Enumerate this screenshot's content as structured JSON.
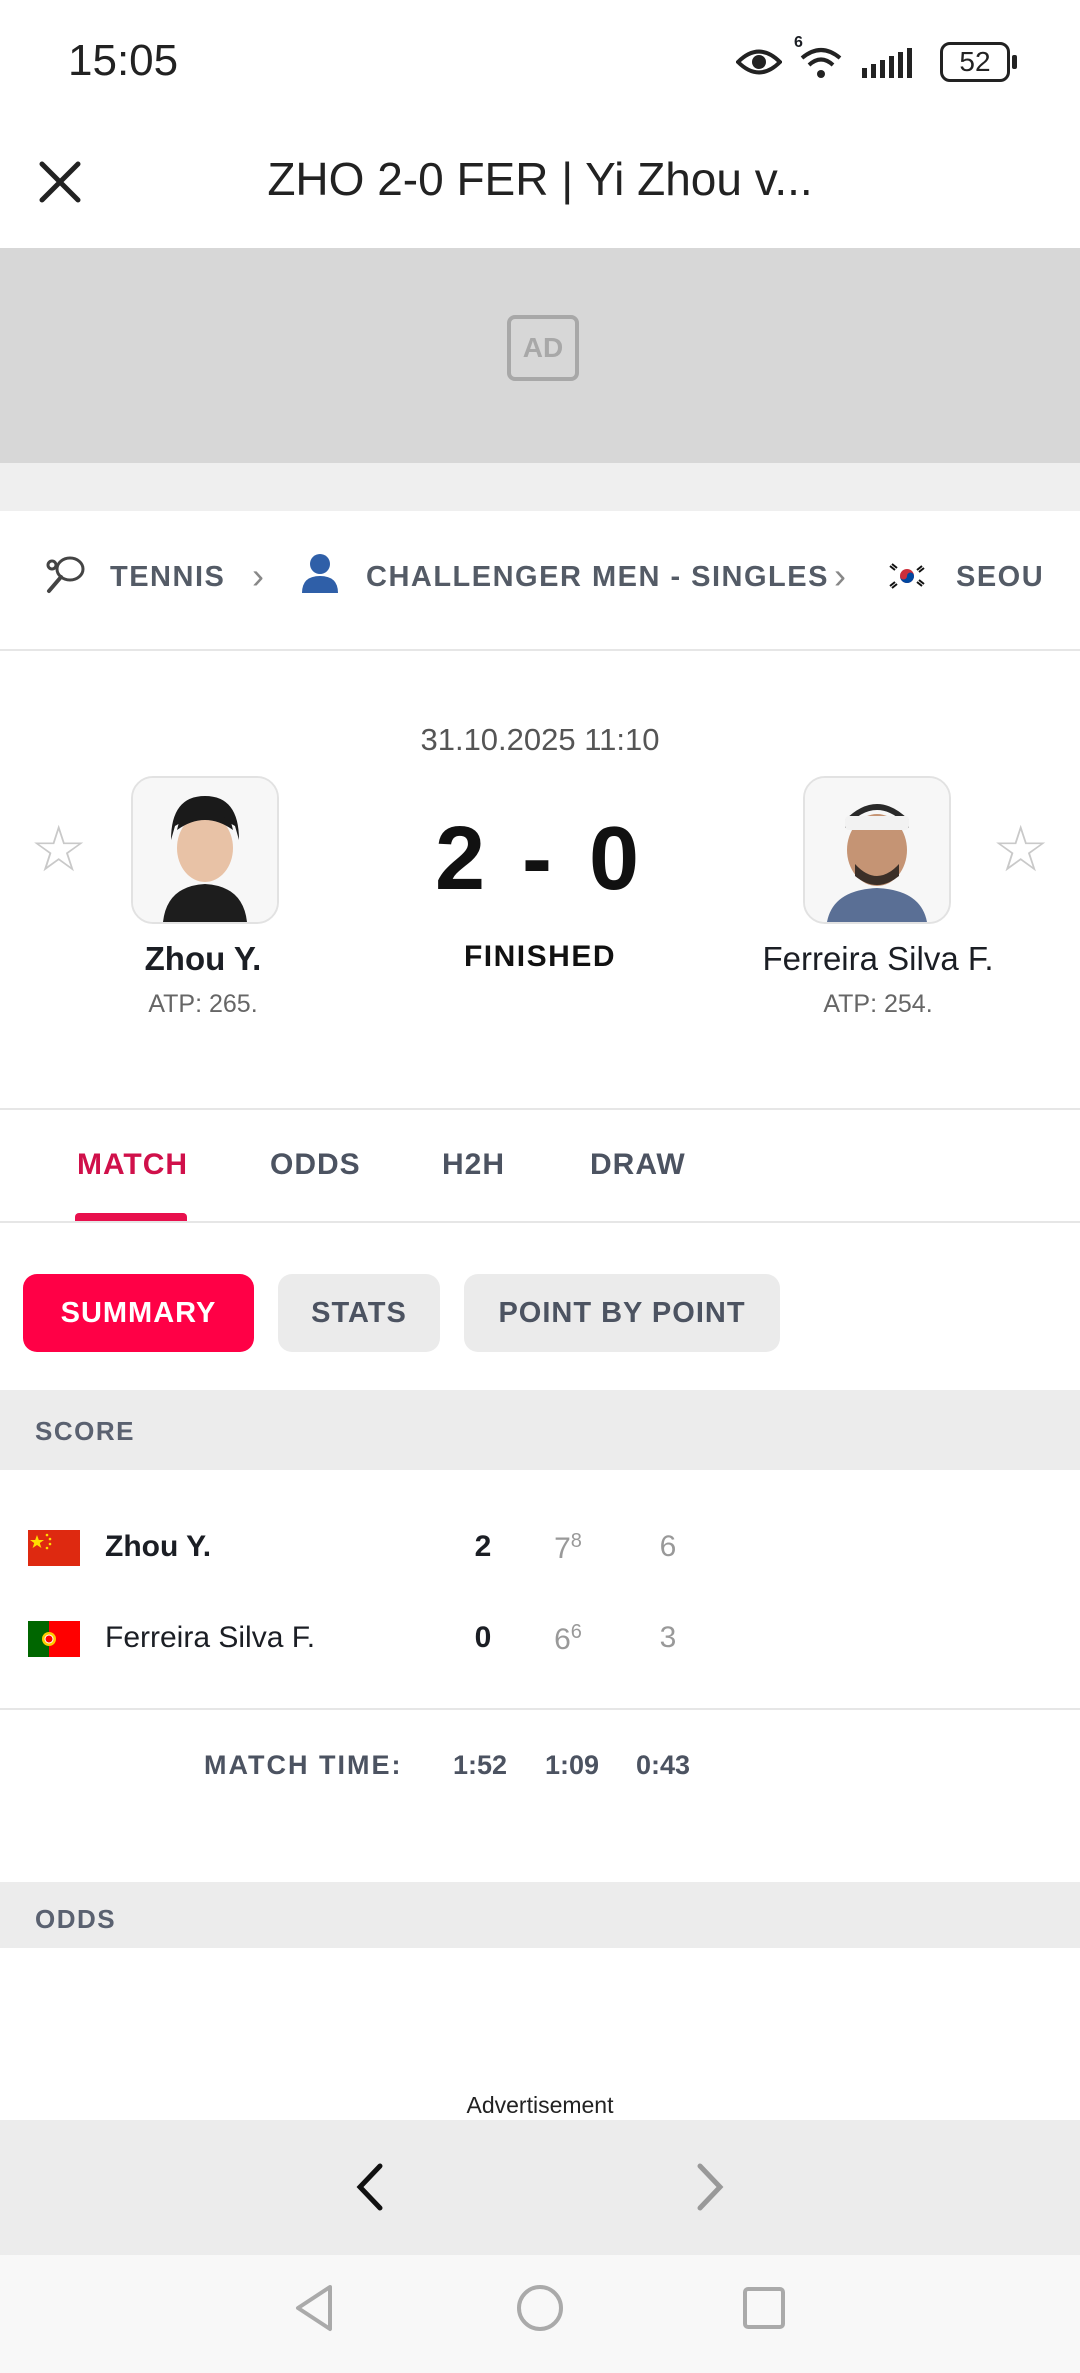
{
  "status_bar": {
    "time": "15:05",
    "battery": "52",
    "wifi_badge": "6"
  },
  "header": {
    "title": "ZHO 2-0 FER | Yi Zhou v..."
  },
  "ad": {
    "label": "AD"
  },
  "breadcrumb": [
    {
      "label": "TENNIS",
      "icon": "tennis-racket-icon"
    },
    {
      "label": "CHALLENGER MEN - SINGLES",
      "icon": "person-icon"
    },
    {
      "label": "SEOU",
      "icon": "korea-flag-icon"
    }
  ],
  "match": {
    "datetime": "31.10.2025 11:10",
    "score": "2 - 0",
    "status": "FINISHED",
    "home": {
      "name": "Zhou Y.",
      "rank": "ATP: 265."
    },
    "away": {
      "name": "Ferreira Silva F.",
      "rank": "ATP: 254."
    }
  },
  "tabs": [
    {
      "label": "MATCH",
      "active": true
    },
    {
      "label": "ODDS",
      "active": false
    },
    {
      "label": "H2H",
      "active": false
    },
    {
      "label": "DRAW",
      "active": false
    }
  ],
  "subtabs": [
    {
      "label": "SUMMARY",
      "active": true
    },
    {
      "label": "STATS",
      "active": false
    },
    {
      "label": "POINT BY POINT",
      "active": false
    }
  ],
  "score_section": {
    "title": "SCORE",
    "rows": [
      {
        "name": "Zhou Y.",
        "sets": "2",
        "set1": "7",
        "set1_tb": "8",
        "set2": "6",
        "flag": "china"
      },
      {
        "name": "Ferreira Silva F.",
        "sets": "0",
        "set1": "6",
        "set1_tb": "6",
        "set2": "3",
        "flag": "portugal"
      }
    ],
    "match_time_label": "MATCH TIME:",
    "match_time_total": "1:52",
    "match_time_set1": "1:09",
    "match_time_set2": "0:43"
  },
  "odds_section": {
    "title": "ODDS"
  },
  "advertisement_label": "Advertisement",
  "colors": {
    "accent": "#ff0046",
    "tab_active": "#d0104a"
  }
}
